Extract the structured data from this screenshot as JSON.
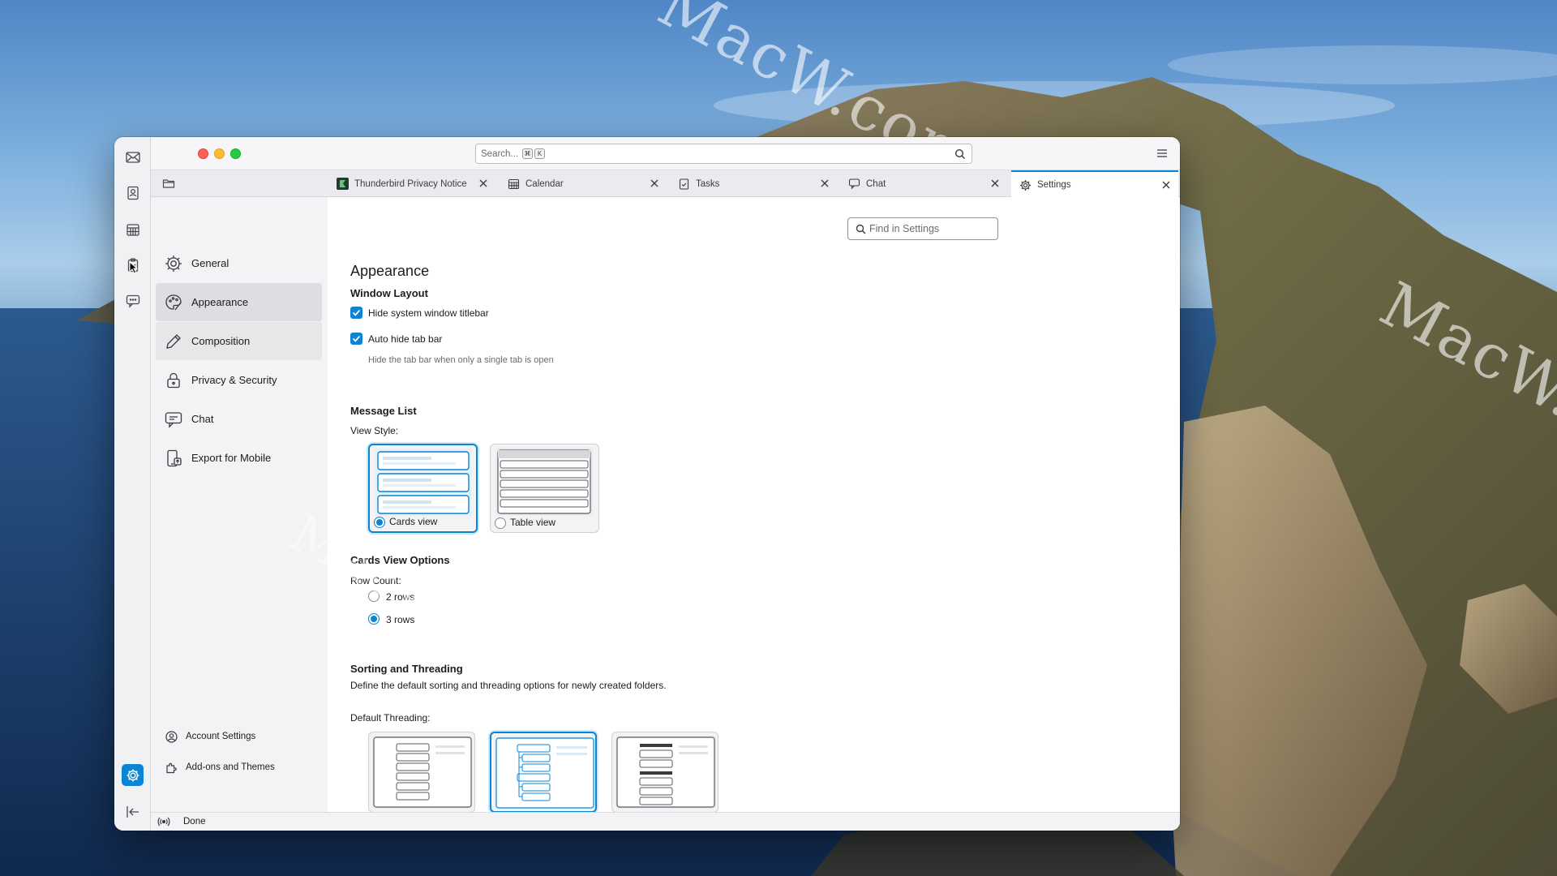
{
  "desktop": {
    "watermarks": [
      "MacW.com",
      "MacW.com",
      "MacW.com"
    ]
  },
  "titlebar": {
    "search_placeholder": "Search...",
    "search_shortcut": [
      "⌘",
      "K"
    ]
  },
  "spaces": [
    "mail-icon",
    "address-book-icon",
    "calendar-icon",
    "tasks-icon",
    "chat-icon"
  ],
  "tabs": [
    {
      "label": "Thunderbird Privacy Notice",
      "icon": "thunderbird-icon"
    },
    {
      "label": "Calendar",
      "icon": "calendar-icon"
    },
    {
      "label": "Tasks",
      "icon": "tasks-icon"
    },
    {
      "label": "Chat",
      "icon": "chat-icon"
    },
    {
      "label": "Settings",
      "icon": "gear-icon",
      "active": true
    }
  ],
  "nav": {
    "items": [
      {
        "label": "General"
      },
      {
        "label": "Appearance",
        "selected": true
      },
      {
        "label": "Composition"
      },
      {
        "label": "Privacy & Security"
      },
      {
        "label": "Chat"
      },
      {
        "label": "Export for Mobile"
      }
    ],
    "links": [
      {
        "label": "Account Settings"
      },
      {
        "label": "Add-ons and Themes"
      }
    ]
  },
  "content": {
    "find_placeholder": "Find in Settings",
    "title": "Appearance",
    "window_layout": {
      "heading": "Window Layout",
      "hide_titlebar": "Hide system window titlebar",
      "auto_hide_tabbar": "Auto hide tab bar",
      "auto_hide_hint": "Hide the tab bar when only a single tab is open"
    },
    "message_list": {
      "heading": "Message List",
      "view_style_label": "View Style:",
      "cards_view": "Cards view",
      "table_view": "Table view",
      "selected": "Cards view"
    },
    "cards_options": {
      "heading": "Cards View Options",
      "row_count_label": "Row Count:",
      "rows_2": "2 rows",
      "rows_3": "3 rows",
      "selected": "3 rows"
    },
    "sorting": {
      "heading": "Sorting and Threading",
      "description": "Define the default sorting and threading options for newly created folders.",
      "default_threading_label": "Default Threading:"
    }
  },
  "status": {
    "text": "Done"
  },
  "colors": {
    "accent": "#0a84d4",
    "close": "#fe5f57",
    "minimize": "#febb2e",
    "maximize": "#28c840"
  }
}
